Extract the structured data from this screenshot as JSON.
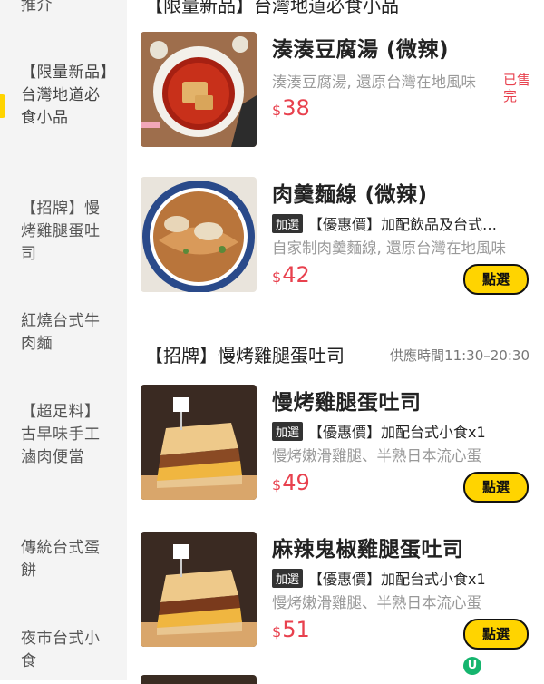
{
  "sidebar": {
    "items": [
      {
        "label": "推介"
      },
      {
        "label": "【限量新品】台灣地道必食小品"
      },
      {
        "label": "【招牌】慢烤雞腿蛋吐司"
      },
      {
        "label": "紅燒台式牛肉麵"
      },
      {
        "label": "【超足料】古早味手工滷肉便當"
      },
      {
        "label": "傳統台式蛋餅"
      },
      {
        "label": "夜市台式小食"
      }
    ],
    "active_index": 1,
    "accent": "#ffd400"
  },
  "sections": [
    {
      "title": "【限量新品】台灣地道必食小品",
      "hours": ""
    },
    {
      "title": "【招牌】慢烤雞腿蛋吐司",
      "hours": "供應時間11:30–20:30"
    }
  ],
  "items": [
    {
      "name": "湊湊豆腐湯 (微辣)",
      "promo_tag": "",
      "promo": "",
      "desc": "湊湊豆腐湯, 還原台灣在地風味",
      "currency": "$",
      "price": "38",
      "status": "已售完",
      "button": ""
    },
    {
      "name": "肉羹麵線 (微辣)",
      "promo_tag": "加選",
      "promo": "【優惠價】加配飲品及台式…",
      "desc": "自家制肉羹麵線, 還原台灣在地風味",
      "currency": "$",
      "price": "42",
      "status": "",
      "button": "點選"
    },
    {
      "name": "慢烤雞腿蛋吐司",
      "promo_tag": "加選",
      "promo": "【優惠價】加配台式小食x1",
      "desc": "慢烤嫩滑雞腿、半熟日本流心蛋",
      "currency": "$",
      "price": "49",
      "status": "",
      "button": "點選"
    },
    {
      "name": "麻辣鬼椒雞腿蛋吐司",
      "promo_tag": "加選",
      "promo": "【優惠價】加配台式小食x1",
      "desc": "慢烤嫩滑雞腿、半熟日本流心蛋",
      "currency": "$",
      "price": "51",
      "status": "",
      "button": "點選"
    }
  ],
  "colors": {
    "price": "#e8414e",
    "button": "#ffd400",
    "tag_bg": "#333333"
  },
  "fab": {
    "icon": "chat-icon",
    "label": "U"
  }
}
